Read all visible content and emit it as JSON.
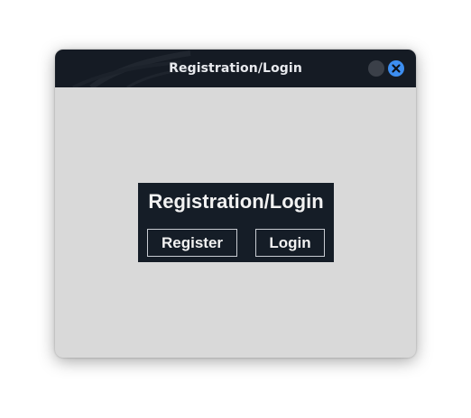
{
  "window": {
    "title": "Registration/Login",
    "buttons": [
      {
        "name": "minimize",
        "icon": "minimize-icon",
        "color": "#3b4049"
      },
      {
        "name": "close",
        "icon": "close-icon",
        "color": "#3d8ef0"
      }
    ]
  },
  "panel": {
    "title": "Registration/Login",
    "register_label": "Register",
    "login_label": "Login"
  },
  "colors": {
    "titlebar": "#151b24",
    "window_bg": "#d9d9d9",
    "panel_bg": "#151d27",
    "accent": "#3d8ef0"
  }
}
